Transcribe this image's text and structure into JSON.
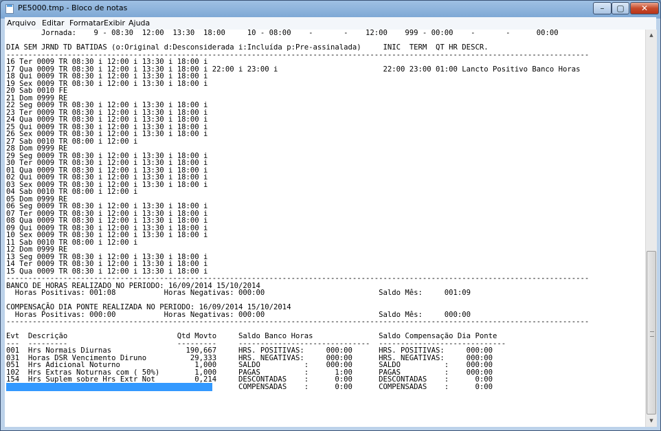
{
  "window": {
    "title": "PE5000.tmp - Bloco de notas"
  },
  "controls": {
    "minimize": "–",
    "maximize": "▢",
    "close": "✕"
  },
  "menu": [
    {
      "label": "Arquivo"
    },
    {
      "label": "Editar"
    },
    {
      "label": "Formatar"
    },
    {
      "label": "Exibir"
    },
    {
      "label": "Ajuda"
    }
  ],
  "document": {
    "lines": [
      "        Jornada:    9 - 08:30  12:00  13:30  18:00     10 - 08:00    -       -    12:00    999 - 00:00    -       -      00:00",
      "",
      "DIA SEM JRND TD BATIDAS (o:Original d:Desconsiderada i:Incluída p:Pre-assinalada)     INIC  TERM  QT HR DESCR.",
      "-------------------------------------------------------------------------------------------------------------------------------------",
      "16 Ter 0009 TR 08:30 i 12:00 i 13:30 i 18:00 i",
      "17 Qua 0009 TR 08:30 i 12:00 i 13:30 i 18:00 i 22:00 i 23:00 i                        22:00 23:00 01:00 Lancto Positivo Banco Horas",
      "18 Qui 0009 TR 08:30 i 12:00 i 13:30 i 18:00 i",
      "19 Sex 0009 TR 08:30 i 12:00 i 13:30 i 18:00 i",
      "20 Sab 0010 FE",
      "21 Dom 0999 RE",
      "22 Seg 0009 TR 08:30 i 12:00 i 13:30 i 18:00 i",
      "23 Ter 0009 TR 08:30 i 12:00 i 13:30 i 18:00 i",
      "24 Qua 0009 TR 08:30 i 12:00 i 13:30 i 18:00 i",
      "25 Qui 0009 TR 08:30 i 12:00 i 13:30 i 18:00 i",
      "26 Sex 0009 TR 08:30 i 12:00 i 13:30 i 18:00 i",
      "27 Sab 0010 TR 08:00 i 12:00 i",
      "28 Dom 0999 RE",
      "29 Seg 0009 TR 08:30 i 12:00 i 13:30 i 18:00 i",
      "30 Ter 0009 TR 08:30 i 12:00 i 13:30 i 18:00 i",
      "01 Qua 0009 TR 08:30 i 12:00 i 13:30 i 18:00 i",
      "02 Qui 0009 TR 08:30 i 12:00 i 13:30 i 18:00 i",
      "03 Sex 0009 TR 08:30 i 12:00 i 13:30 i 18:00 i",
      "04 Sab 0010 TR 08:00 i 12:00 i",
      "05 Dom 0999 RE",
      "06 Seg 0009 TR 08:30 i 12:00 i 13:30 i 18:00 i",
      "07 Ter 0009 TR 08:30 i 12:00 i 13:30 i 18:00 i",
      "08 Qua 0009 TR 08:30 i 12:00 i 13:30 i 18:00 i",
      "09 Qui 0009 TR 08:30 i 12:00 i 13:30 i 18:00 i",
      "10 Sex 0009 TR 08:30 i 12:00 i 13:30 i 18:00 i",
      "11 Sab 0010 TR 08:00 i 12:00 i",
      "12 Dom 0999 RE",
      "13 Seg 0009 TR 08:30 i 12:00 i 13:30 i 18:00 i",
      "14 Ter 0009 TR 08:30 i 12:00 i 13:30 i 18:00 i",
      "15 Qua 0009 TR 08:30 i 12:00 i 13:30 i 18:00 i",
      "-------------------------------------------------------------------------------------------------------------------------------------",
      "BANCO DE HORAS REALIZADO NO PERIODO: 16/09/2014 15/10/2014",
      "  Horas Positivas: 001:08           Horas Negativas: 000:00                          Saldo Mês:     001:09",
      "",
      "COMPENSAÇÃO DIA PONTE REALIZADA NO PERIODO: 16/09/2014 15/10/2014",
      "  Horas Positivas: 000:00           Horas Negativas: 000:00                          Saldo Mês:     000:00",
      "-------------------------------------------------------------------------------------------------------------------------------------",
      "",
      "Evt  Descrição                         Qtd Movto     Saldo Banco Horas               Saldo Compensação Dia Ponte",
      "---  ---------                         ---------     ------------------------------  -----------------------------",
      "001  Hrs Normais Diurnas                 190,667     HRS. POSITIVAS:     000:00      HRS. POSITIVAS:     000:00",
      "031  Horas DSR Vencimento Diruno          29,333     HRS. NEGATIVAS:     000:00      HRS. NEGATIVAS:     000:00",
      "051  Hrs Adicional Noturno                 1,000     SALDO          :    000:00      SALDO          :    000:00",
      "102  Hrs Extras Noturnas com ( 50%)        1,000     PAGAS          :      1:00      PAGAS          :    000:00",
      "154  Hrs Suplem sobre Hrs Extr Not         0,214     DESCONTADAS    :      0:00      DESCONTADAS    :      0:00",
      "                                                     COMPENSADAS    :      0:00      COMPENSADAS    :      0:00"
    ],
    "selected_line_index": 49,
    "selected_chars": 47
  }
}
